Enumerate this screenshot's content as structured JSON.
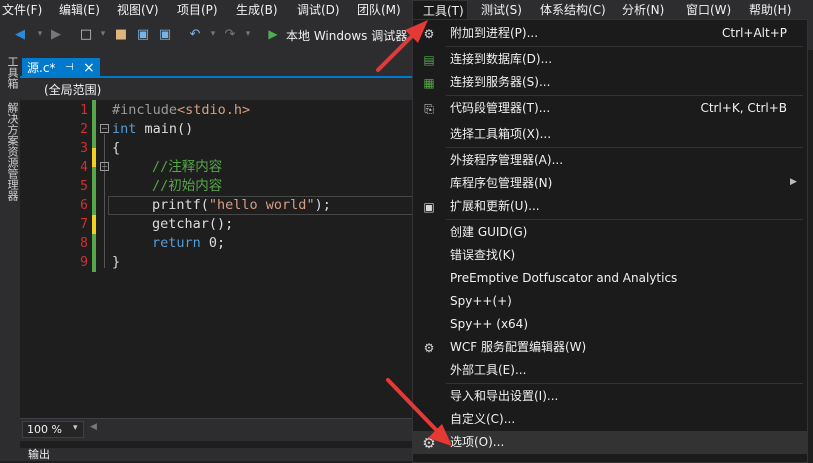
{
  "menubar": {
    "items": [
      "文件(F)",
      "编辑(E)",
      "视图(V)",
      "项目(P)",
      "生成(B)",
      "调试(D)",
      "团队(M)",
      "工具(T)",
      "测试(S)",
      "体系结构(C)",
      "分析(N)",
      "窗口(W)",
      "帮助(H)"
    ]
  },
  "toolbar": {
    "run_label": "本地 Windows 调试器"
  },
  "left_panels": {
    "toolbox": "工具箱",
    "solution_explorer": "解决方案资源管理器"
  },
  "tab": {
    "title": "源.c*",
    "pin": "⊣",
    "close": "×"
  },
  "scope": "(全局范围)",
  "code_lines": {
    "numbers": [
      "1",
      "2",
      "3",
      "4",
      "5",
      "6",
      "7",
      "8",
      "9"
    ],
    "l1a": "#include",
    "l1b": "<stdio.h>",
    "l2a": "int",
    "l2b": " main()",
    "l3": "{",
    "l4": "//注释内容",
    "l5": "//初始内容",
    "l6a": "printf(",
    "l6b": "\"hello world\"",
    "l6c": ");",
    "l7": "getchar();",
    "l8a": "return",
    "l8b": " 0;",
    "l9": "}"
  },
  "zoom": "100 %",
  "output_label": "输出",
  "tools_menu": {
    "items": [
      {
        "label": "附加到进程(P)...",
        "shortcut": "Ctrl+Alt+P",
        "icon": "attach-icon"
      },
      {
        "label": "连接到数据库(D)...",
        "shortcut": "",
        "icon": "database-connect-icon"
      },
      {
        "label": "连接到服务器(S)...",
        "shortcut": "",
        "icon": "server-connect-icon"
      },
      {
        "label": "代码段管理器(T)...",
        "shortcut": "Ctrl+K, Ctrl+B",
        "icon": "snippet-icon"
      },
      {
        "label": "选择工具箱项(X)...",
        "shortcut": "",
        "icon": ""
      },
      {
        "label": "外接程序管理器(A)...",
        "shortcut": "",
        "icon": ""
      },
      {
        "label": "库程序包管理器(N)",
        "shortcut": "",
        "icon": ""
      },
      {
        "label": "扩展和更新(U)...",
        "shortcut": "",
        "icon": "extensions-icon"
      },
      {
        "label": "创建 GUID(G)",
        "shortcut": "",
        "icon": ""
      },
      {
        "label": "错误查找(K)",
        "shortcut": "",
        "icon": ""
      },
      {
        "label": "PreEmptive Dotfuscator and Analytics",
        "shortcut": "",
        "icon": ""
      },
      {
        "label": "Spy++(+)",
        "shortcut": "",
        "icon": ""
      },
      {
        "label": "Spy++ (x64)",
        "shortcut": "",
        "icon": ""
      },
      {
        "label": "WCF 服务配置编辑器(W)",
        "shortcut": "",
        "icon": "wcf-gear-icon"
      },
      {
        "label": "外部工具(E)...",
        "shortcut": "",
        "icon": ""
      },
      {
        "label": "导入和导出设置(I)...",
        "shortcut": "",
        "icon": ""
      },
      {
        "label": "自定义(C)...",
        "shortcut": "",
        "icon": ""
      },
      {
        "label": "选项(O)...",
        "shortcut": "",
        "icon": "options-gear-icon"
      }
    ]
  },
  "colors": {
    "accent": "#007acc",
    "arrow": "#e53935",
    "line_number": "#d32f2f",
    "keyword": "#569cd6",
    "comment": "#57a64a",
    "string": "#d69d85"
  }
}
